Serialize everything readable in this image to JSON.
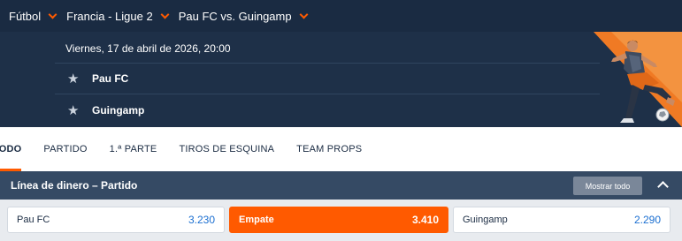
{
  "breadcrumb": {
    "items": [
      {
        "label": "Fútbol"
      },
      {
        "label": "Francia - Ligue 2"
      },
      {
        "label": "Pau FC vs. Guingamp"
      }
    ]
  },
  "event": {
    "datetime": "Viernes, 17 de abril de 2026, 20:00",
    "home_team": "Pau FC",
    "away_team": "Guingamp",
    "favorite_icon": "star-icon",
    "promo_image": "soccer-player-illustration"
  },
  "tabs": [
    {
      "label": "TODO",
      "active": true
    },
    {
      "label": "PARTIDO",
      "active": false
    },
    {
      "label": "1.ª PARTE",
      "active": false
    },
    {
      "label": "TIROS DE ESQUINA",
      "active": false
    },
    {
      "label": "TEAM PROPS",
      "active": false
    }
  ],
  "market": {
    "title": "Línea de dinero – Partido",
    "show_all_label": "Mostrar todo",
    "collapse_icon": "chevron-up-icon"
  },
  "odds": [
    {
      "label": "Pau FC",
      "value": "3.230",
      "selected": false
    },
    {
      "label": "Empate",
      "value": "3.410",
      "selected": true
    },
    {
      "label": "Guingamp",
      "value": "2.290",
      "selected": false
    }
  ],
  "colors": {
    "accent": "#ff5a00",
    "header_bg": "#1a2b42",
    "event_bg": "#1e3048",
    "market_bg": "#354a64",
    "odds_value": "#1b6fd1"
  }
}
